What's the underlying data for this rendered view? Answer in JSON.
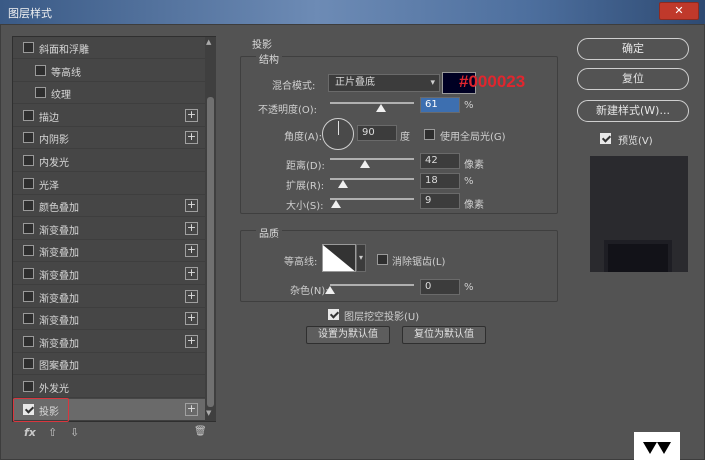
{
  "window": {
    "title": "图层样式",
    "close_label": "✕"
  },
  "style_list": {
    "items": [
      {
        "label": "斜面和浮雕",
        "checked": false,
        "plus": false,
        "indent": 0
      },
      {
        "label": "等高线",
        "checked": false,
        "plus": false,
        "indent": 1
      },
      {
        "label": "纹理",
        "checked": false,
        "plus": false,
        "indent": 1
      },
      {
        "label": "描边",
        "checked": false,
        "plus": true,
        "indent": 0
      },
      {
        "label": "内阴影",
        "checked": false,
        "plus": true,
        "indent": 0
      },
      {
        "label": "内发光",
        "checked": false,
        "plus": false,
        "indent": 0
      },
      {
        "label": "光泽",
        "checked": false,
        "plus": false,
        "indent": 0
      },
      {
        "label": "颜色叠加",
        "checked": false,
        "plus": true,
        "indent": 0
      },
      {
        "label": "渐变叠加",
        "checked": false,
        "plus": true,
        "indent": 0
      },
      {
        "label": "渐变叠加",
        "checked": false,
        "plus": true,
        "indent": 0
      },
      {
        "label": "渐变叠加",
        "checked": false,
        "plus": true,
        "indent": 0
      },
      {
        "label": "渐变叠加",
        "checked": false,
        "plus": true,
        "indent": 0
      },
      {
        "label": "渐变叠加",
        "checked": false,
        "plus": true,
        "indent": 0
      },
      {
        "label": "渐变叠加",
        "checked": false,
        "plus": true,
        "indent": 0
      },
      {
        "label": "图案叠加",
        "checked": false,
        "plus": false,
        "indent": 0
      },
      {
        "label": "外发光",
        "checked": false,
        "plus": false,
        "indent": 0
      },
      {
        "label": "投影",
        "checked": true,
        "plus": true,
        "indent": 0,
        "selected": true
      }
    ],
    "plus_symbol": "+",
    "bottom": {
      "fx": "fx",
      "up": "⇧",
      "down": "⇩",
      "trash": "🗑"
    }
  },
  "shadow": {
    "section_title": "投影",
    "structure": {
      "title": "结构",
      "blend_mode_label": "混合模式:",
      "blend_mode_value": "正片叠底",
      "color_hex": "#000023",
      "color_annotation": "#000023",
      "opacity_label": "不透明度(O):",
      "opacity_value": "61",
      "opacity_unit": "%",
      "angle_label": "角度(A):",
      "angle_value": "90",
      "angle_unit": "度",
      "global_light_label": "使用全局光(G)",
      "global_light_checked": false,
      "distance_label": "距离(D):",
      "distance_value": "42",
      "distance_unit": "像素",
      "spread_label": "扩展(R):",
      "spread_value": "18",
      "spread_unit": "%",
      "size_label": "大小(S):",
      "size_value": "9",
      "size_unit": "像素"
    },
    "quality": {
      "title": "品质",
      "contour_label": "等高线:",
      "antialias_label": "消除锯齿(L)",
      "antialias_checked": false,
      "noise_label": "杂色(N):",
      "noise_value": "0",
      "noise_unit": "%"
    },
    "knockout_label": "图层挖空投影(U)",
    "knockout_checked": true,
    "set_default_label": "设置为默认值",
    "reset_default_label": "复位为默认值"
  },
  "right_panel": {
    "ok_label": "确定",
    "reset_label": "复位",
    "new_style_label": "新建样式(W)...",
    "preview_label": "预览(V)",
    "preview_checked": true
  }
}
